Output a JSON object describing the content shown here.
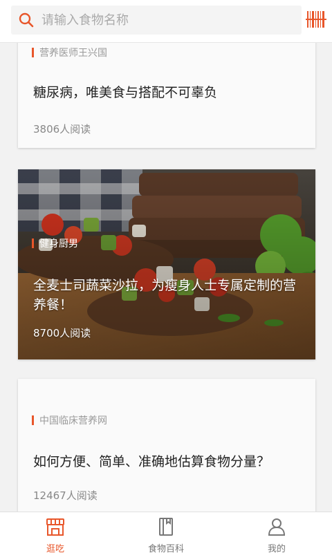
{
  "search": {
    "placeholder": "请输入食物名称",
    "icon": "search-icon",
    "scan_icon": "barcode-scan-icon"
  },
  "colors": {
    "accent": "#e8562a",
    "background": "#f2f2f2",
    "card": "#fafafa"
  },
  "feed": {
    "articles": [
      {
        "source": "营养医师王兴国",
        "title": "糖尿病，唯美食与搭配不可辜负",
        "reads": "3806人阅读"
      },
      {
        "source": "健身厨男",
        "title": "全麦士司蔬菜沙拉，为瘦身人士专属定制的营养餐！",
        "reads": "8700人阅读"
      },
      {
        "source": "中国临床营养网",
        "title": "如何方便、简单、准确地估算食物分量？",
        "reads": "12467人阅读"
      }
    ]
  },
  "bottom_nav": {
    "items": [
      {
        "label": "逛吃",
        "icon": "store-icon",
        "active": true
      },
      {
        "label": "食物百科",
        "icon": "book-icon",
        "active": false
      },
      {
        "label": "我的",
        "icon": "user-icon",
        "active": false
      }
    ]
  }
}
